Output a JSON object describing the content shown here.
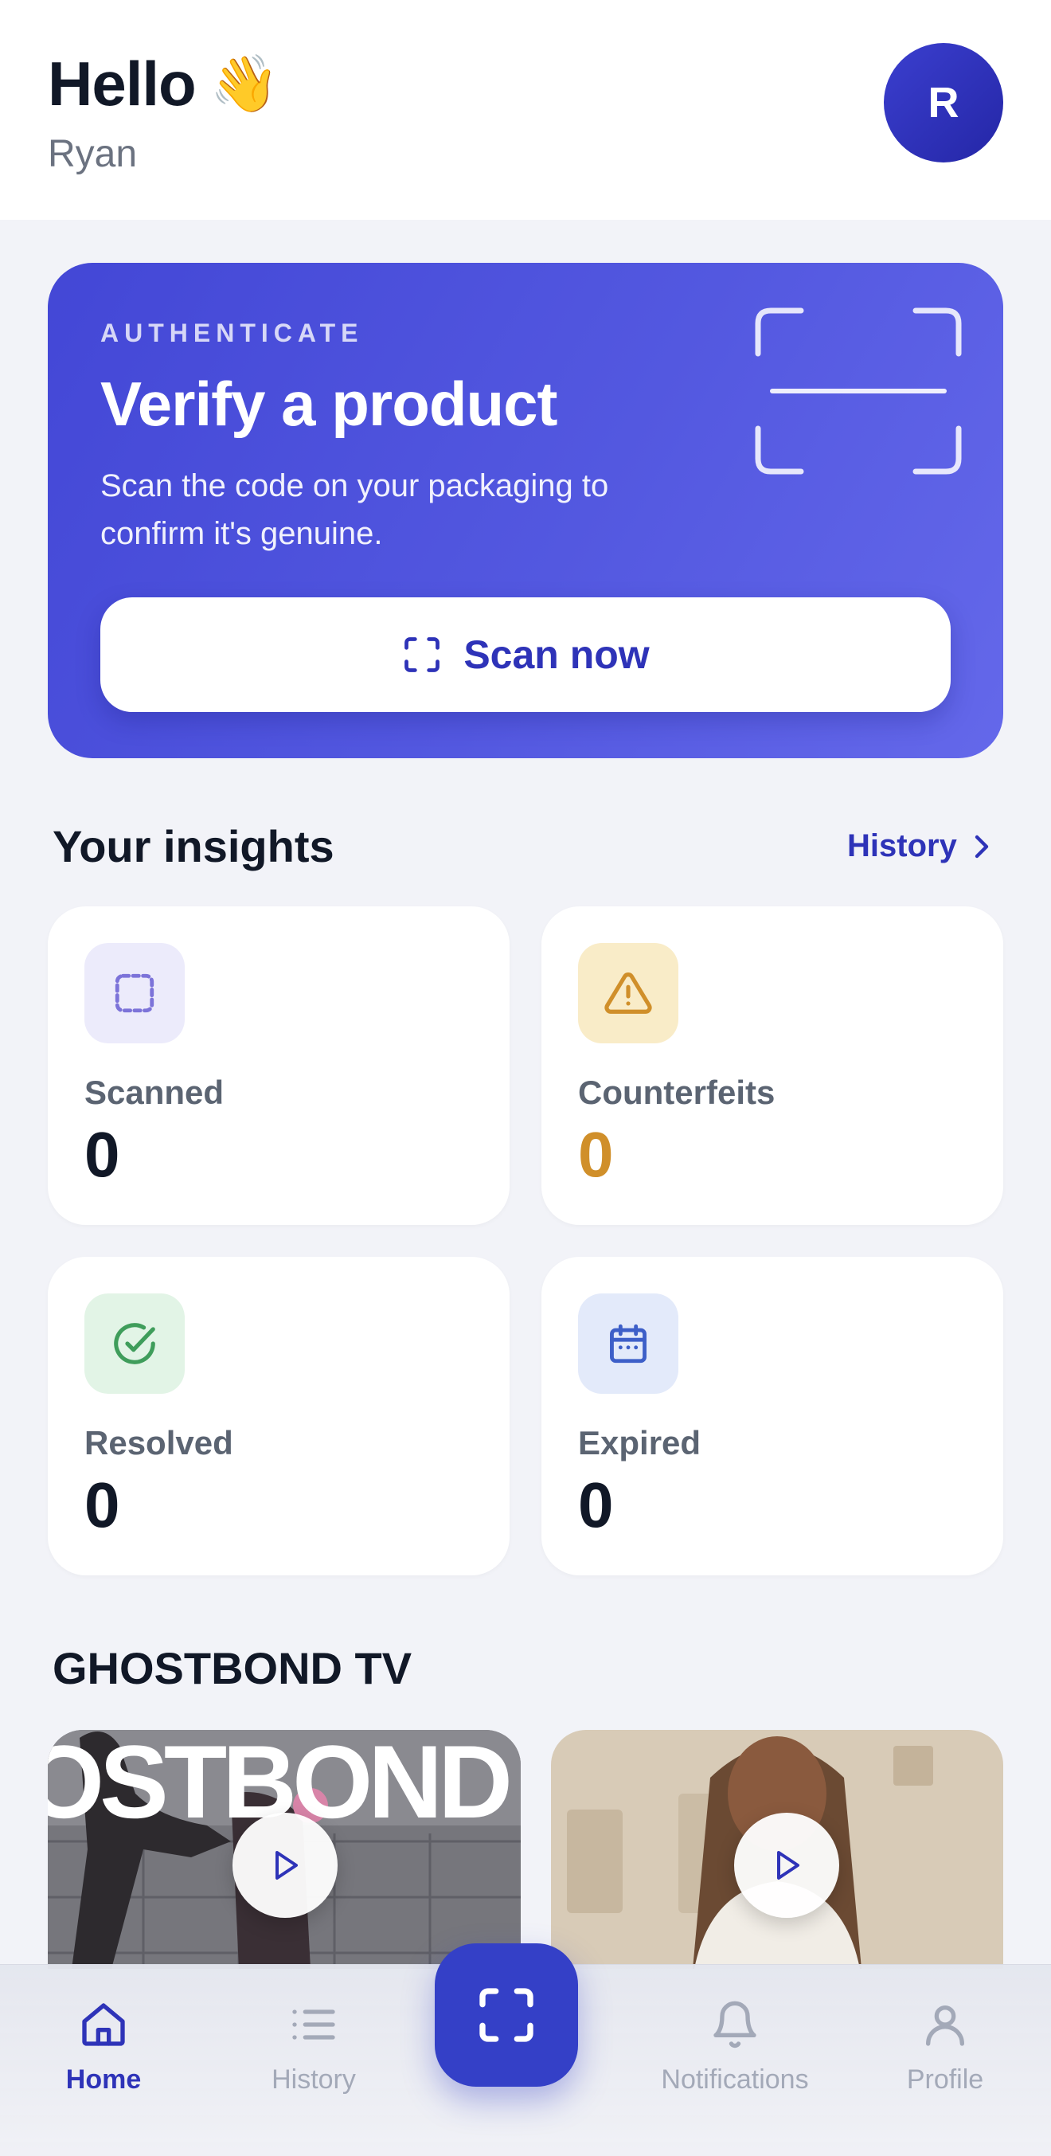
{
  "header": {
    "greeting": "Hello",
    "wave_emoji": "👋",
    "username": "Ryan",
    "avatar_initial": "R"
  },
  "hero": {
    "eyebrow": "AUTHENTICATE",
    "title": "Verify a product",
    "description": "Scan the code on your packaging to confirm it's genuine.",
    "button_label": "Scan now"
  },
  "insights": {
    "title": "Your insights",
    "history_link": "History",
    "cards": [
      {
        "label": "Scanned",
        "value": "0",
        "icon": "scan-icon"
      },
      {
        "label": "Counterfeits",
        "value": "0",
        "icon": "warning-icon"
      },
      {
        "label": "Resolved",
        "value": "0",
        "icon": "check-circle-icon"
      },
      {
        "label": "Expired",
        "value": "0",
        "icon": "calendar-icon"
      }
    ]
  },
  "tv": {
    "title": "GHOSTBOND TV",
    "video1_overlay_text": "OSTBOND"
  },
  "nav": {
    "items": [
      {
        "label": "Home",
        "icon": "home-icon",
        "active": true
      },
      {
        "label": "History",
        "icon": "list-icon",
        "active": false
      },
      {
        "label": "Notifications",
        "icon": "bell-icon",
        "active": false
      },
      {
        "label": "Profile",
        "icon": "user-icon",
        "active": false
      }
    ],
    "center_action_icon": "scan-icon"
  },
  "colors": {
    "brand": "#2e33b8",
    "hero_bg": "#4a4fdb",
    "counterfeit_accent": "#d08f2a",
    "resolved_accent": "#3f9d5b",
    "expired_accent": "#3d5fc8",
    "scanned_accent": "#7c73d9"
  }
}
